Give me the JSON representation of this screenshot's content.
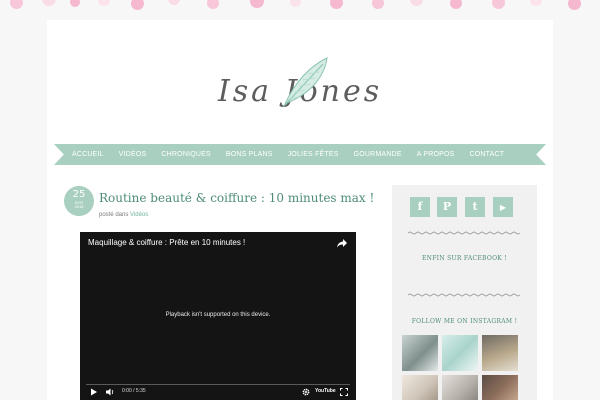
{
  "site": {
    "title": "Isa Jones"
  },
  "nav": {
    "items": [
      "ACCUEIL",
      "VIDÉOS",
      "CHRONIQUES",
      "BONS PLANS",
      "JOLIES FÊTES",
      "GOURMANDE",
      "A PROPOS",
      "CONTACT"
    ]
  },
  "post": {
    "date": {
      "day": "25",
      "month": "AVR",
      "year": "2018"
    },
    "title": "Routine beauté & coiffure : 10 minutes max !",
    "meta_prefix": "posté dans",
    "category": "Vidéos"
  },
  "video": {
    "title": "Maquillage & coiffure : Prête en 10 minutes !",
    "message": "Playback isn't supported on this device.",
    "time": "0:00 / 5:35",
    "logo": "YouTube"
  },
  "sidebar": {
    "social": [
      {
        "icon": "facebook-icon",
        "glyph": "f"
      },
      {
        "icon": "pinterest-icon",
        "glyph": "P"
      },
      {
        "icon": "twitter-icon",
        "glyph": "t"
      },
      {
        "icon": "youtube-icon",
        "glyph": "▶"
      }
    ],
    "facebook_heading": "ENFIN SUR FACEBOOK !",
    "instagram_heading": "FOLLOW ME ON INSTAGRAM !"
  },
  "colors": {
    "accent": "#a8cfc0",
    "title": "#4e8c78",
    "dots": "#f5b8cf"
  }
}
